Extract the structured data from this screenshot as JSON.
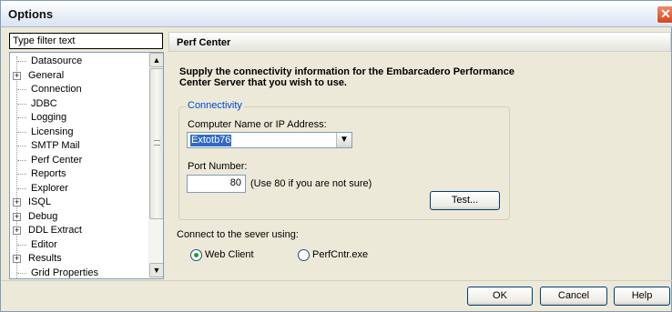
{
  "window": {
    "title": "Options",
    "close_glyph": "✕"
  },
  "filter": {
    "value": "Type filter text"
  },
  "tree": {
    "items": [
      {
        "label": "Datasource",
        "expandable": false
      },
      {
        "label": "General",
        "expandable": true
      },
      {
        "label": "Connection",
        "expandable": false
      },
      {
        "label": "JDBC",
        "expandable": false
      },
      {
        "label": "Logging",
        "expandable": false
      },
      {
        "label": "Licensing",
        "expandable": false
      },
      {
        "label": "SMTP Mail",
        "expandable": false
      },
      {
        "label": "Perf Center",
        "expandable": false
      },
      {
        "label": "Reports",
        "expandable": false
      },
      {
        "label": "Explorer",
        "expandable": false
      },
      {
        "label": "ISQL",
        "expandable": true
      },
      {
        "label": "Debug",
        "expandable": true
      },
      {
        "label": "DDL Extract",
        "expandable": true
      },
      {
        "label": "Editor",
        "expandable": false
      },
      {
        "label": "Results",
        "expandable": true
      },
      {
        "label": "Grid Properties",
        "expandable": false
      }
    ],
    "expander_glyph": "+",
    "scroll_up_glyph": "▲",
    "scroll_down_glyph": "▼"
  },
  "panel": {
    "header": "Perf Center",
    "description": "Supply the connectivity information for the Embarcadero Performance Center Server that you wish to use.",
    "connectivity": {
      "legend": "Connectivity",
      "computer_label": "Computer Name or IP Address:",
      "computer_value": "Extotb76",
      "port_label": "Port Number:",
      "port_value": "80",
      "port_hint": "(Use 80 if you are not sure)",
      "test_button": "Test..."
    },
    "connect_label": "Connect to the sever using:",
    "radio_options": [
      {
        "label": "Web Client",
        "selected": true
      },
      {
        "label": "PerfCntr.exe",
        "selected": false
      }
    ]
  },
  "buttons": {
    "ok": "OK",
    "cancel": "Cancel",
    "help": "Help"
  },
  "icons": {
    "combo_dropdown": "chevron-down-icon"
  }
}
